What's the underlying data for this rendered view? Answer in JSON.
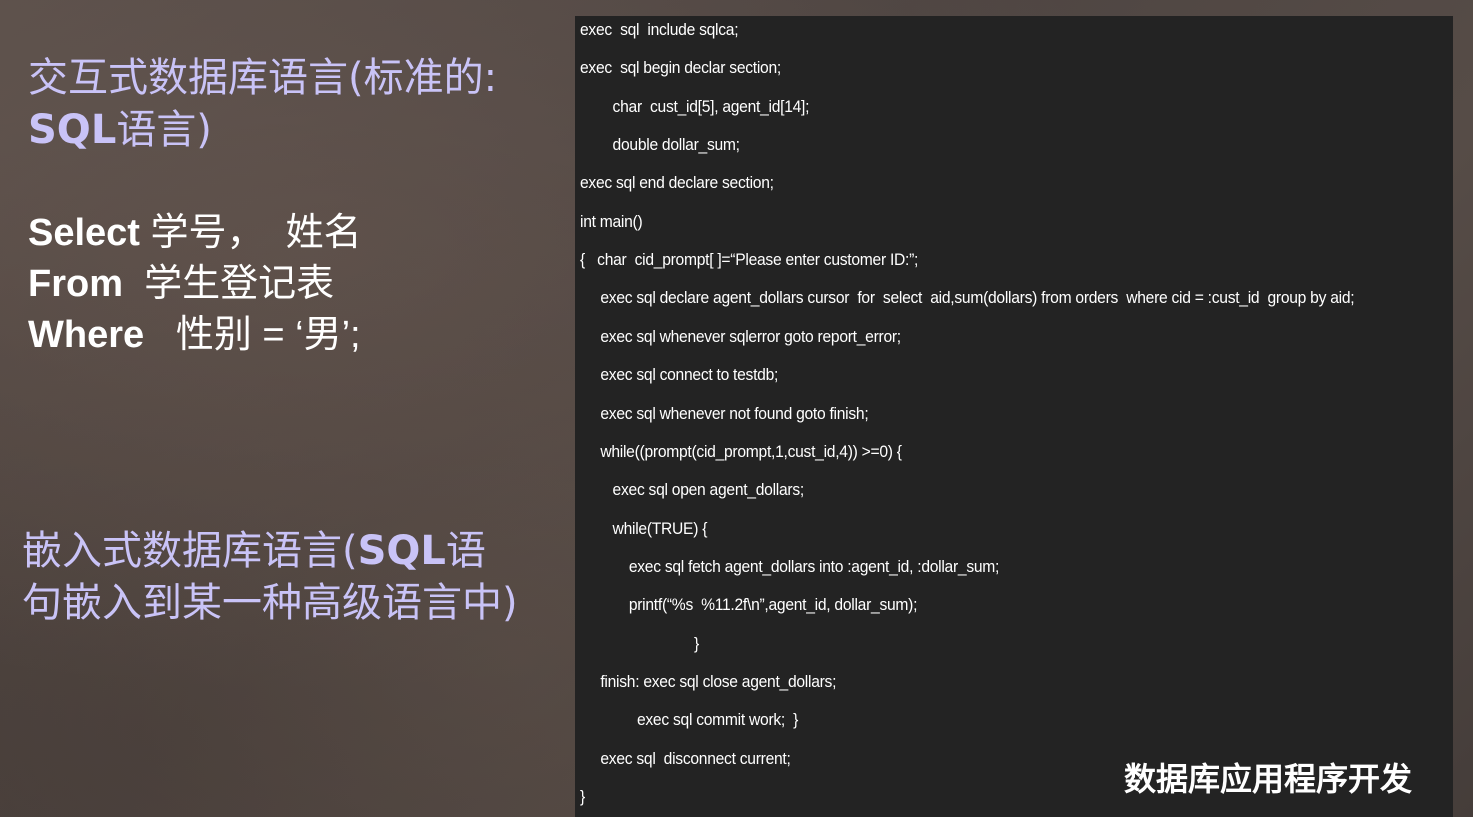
{
  "left": {
    "heading_interactive_line1": "交互式数据库语言(标准的:",
    "heading_interactive_line2_sql": "SQL",
    "heading_interactive_line2_rest": "语言)",
    "query": {
      "select_kw": "Select",
      "select_rest": " 学号，  姓名",
      "from_kw": "From",
      "from_rest": "  学生登记表",
      "where_kw": "Where",
      "where_rest": "   性别 = ‘男’;"
    },
    "heading_embedded_line1_a": "嵌入式数据库语言(",
    "heading_embedded_line1_sql": "SQL",
    "heading_embedded_line1_b": "语",
    "heading_embedded_line2": "句嵌入到某一种高级语言中)"
  },
  "code": {
    "lines": [
      "exec  sql  include sqlca;",
      "exec  sql begin declar section;",
      "        char  cust_id[5], agent_id[14];",
      "        double dollar_sum;",
      "exec sql end declare section;",
      "int main()",
      "{   char  cid_prompt[ ]=“Please enter customer ID:”;",
      "     exec sql declare agent_dollars cursor  for  select  aid,sum(dollars) from orders  where cid = :cust_id  group by aid;",
      "     exec sql whenever sqlerror goto report_error;",
      "     exec sql connect to testdb;",
      "     exec sql whenever not found goto finish;",
      "     while((prompt(cid_prompt,1,cust_id,4)) >=0) {",
      "        exec sql open agent_dollars;",
      "        while(TRUE) {",
      "            exec sql fetch agent_dollars into :agent_id, :dollar_sum;",
      "            printf(“%s  %11.2f\\n”,agent_id, dollar_sum);",
      "                            }",
      "     finish: exec sql close agent_dollars;",
      "              exec sql commit work;  }",
      "     exec sql  disconnect current;",
      "}"
    ]
  },
  "footer": {
    "title": "数据库应用程序开发"
  }
}
